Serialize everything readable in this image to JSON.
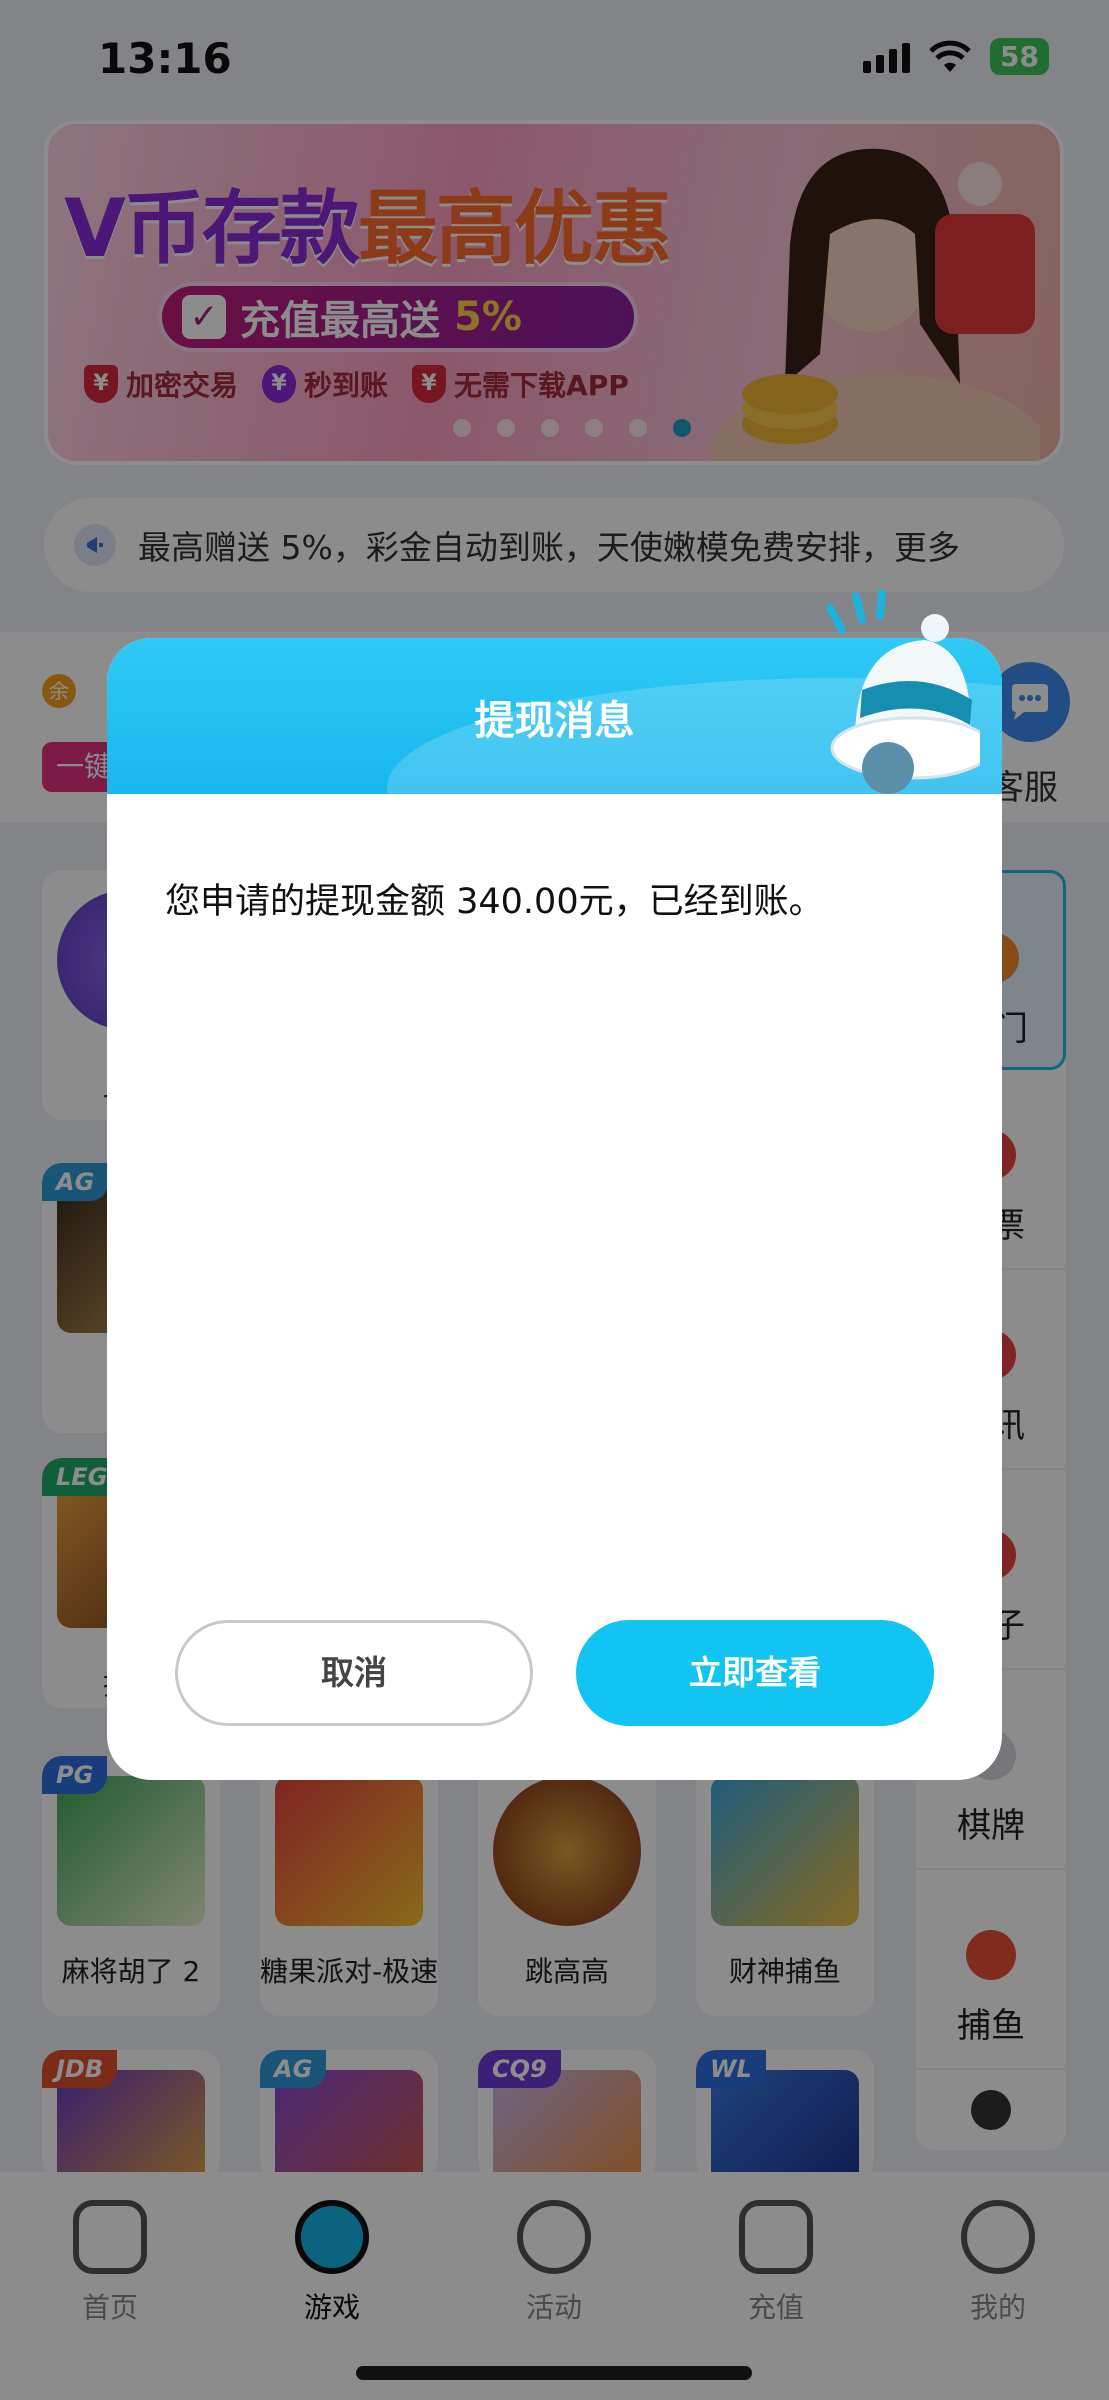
{
  "status_bar": {
    "time": "13:16",
    "battery": "58"
  },
  "banner": {
    "title_part1": "V币存款",
    "title_part2": "最高优惠",
    "pill_text": "充值最高送",
    "pill_percent": "5%",
    "features": [
      "加密交易",
      "秒到账",
      "无需下载APP"
    ]
  },
  "marquee": {
    "text": "最高赠送 5%，彩金自动到账，天使嫩模免费安排，更多"
  },
  "user": {
    "coin_icon": "余",
    "onekey_label": "一键",
    "service_label": "客服"
  },
  "categories": [
    {
      "label": "热门",
      "icon": "fire-icon"
    },
    {
      "label": "彩票",
      "icon": "lottery-icon"
    },
    {
      "label": "电讯",
      "icon": "telecom-icon"
    },
    {
      "label": "骰子",
      "icon": "dice-icon"
    },
    {
      "label": "棋牌",
      "icon": "cards-icon"
    },
    {
      "label": "捕鱼",
      "icon": "fish-icon"
    }
  ],
  "games": [
    {
      "tag": "",
      "label": "一元"
    },
    {
      "tag": "AG",
      "label": "AG"
    },
    {
      "tag": "LEG",
      "label": "抢庄"
    },
    {
      "tag": "PG",
      "label": "麻将胡了 2"
    },
    {
      "tag": "",
      "label": "糖果派对-极速"
    },
    {
      "tag": "",
      "label": "跳高高"
    },
    {
      "tag": "",
      "label": "财神捕鱼"
    },
    {
      "tag": "JDB",
      "label": ""
    },
    {
      "tag": "AG",
      "label": ""
    },
    {
      "tag": "CQ9",
      "label": ""
    },
    {
      "tag": "WL",
      "label": ""
    }
  ],
  "tabs": [
    {
      "label": "首页",
      "icon": "home-icon"
    },
    {
      "label": "游戏",
      "icon": "gamepad-icon"
    },
    {
      "label": "活动",
      "icon": "flag-icon"
    },
    {
      "label": "充值",
      "icon": "wallet-icon"
    },
    {
      "label": "我的",
      "icon": "profile-icon"
    }
  ],
  "modal": {
    "title": "提现消息",
    "message": "您申请的提现金额 340.00元，已经到账。",
    "cancel_label": "取消",
    "view_label": "立即查看"
  },
  "colors": {
    "accent": "#12c4f2",
    "header": "#18b7ee",
    "pink": "#e0307c"
  }
}
